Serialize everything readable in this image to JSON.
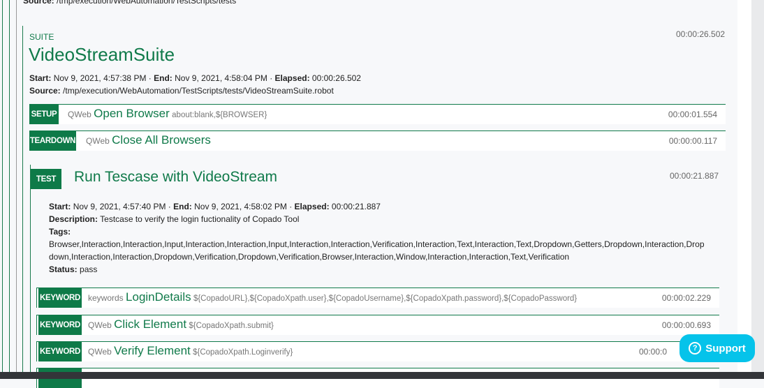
{
  "parent_source": {
    "label": "Source:",
    "value": "/tmp/execution/WebAutomation/TestScripts/tests"
  },
  "suite": {
    "kind": "SUITE",
    "name": "VideoStreamSuite",
    "elapsed": "00:00:26.502",
    "start_label": "Start:",
    "start": "Nov 9, 2021, 4:57:38 PM",
    "end_label": "End:",
    "end": "Nov 9, 2021, 4:58:04 PM",
    "elapsed_label": "Elapsed:",
    "source_label": "Source:",
    "source": "/tmp/execution/WebAutomation/TestScripts/tests/VideoStreamSuite.robot",
    "setup": {
      "badge": "SETUP",
      "lib": "QWeb",
      "name": "Open Browser",
      "args": "about:blank,${BROWSER}",
      "duration": "00:00:01.554"
    },
    "teardown": {
      "badge": "TEARDOWN",
      "lib": "QWeb",
      "name": "Close All Browsers",
      "args": "",
      "duration": "00:00:00.117"
    }
  },
  "test": {
    "badge": "TEST",
    "name": "Run Tescase with VideoStream",
    "duration": "00:00:21.887",
    "start_label": "Start:",
    "start": "Nov 9, 2021, 4:57:40 PM",
    "end_label": "End:",
    "end": "Nov 9, 2021, 4:58:02 PM",
    "elapsed_label": "Elapsed:",
    "elapsed": "00:00:21.887",
    "description_label": "Description:",
    "description": "Testcase to verify the login fuctionality of Copado Tool",
    "tags_label": "Tags:",
    "tags_line1": "Browser,Interaction,Interaction,Input,Interaction,Interaction,Input,Interaction,Interaction,Verification,Interaction,Text,Interaction,Text,Dropdown,Getters,Dropdown,Interaction,Drop",
    "tags_line2": "down,Interaction,Interaction,Dropdown,Verification,Dropdown,Verification,Browser,Interaction,Window,Interaction,Interaction,Text,Verification",
    "status_label": "Status:",
    "status": "pass",
    "keywords": [
      {
        "badge": "KEYWORD",
        "lib": "keywords",
        "name": "LoginDetails",
        "args": "${CopadoURL},${CopadoXpath.user},${CopadoUsername},${CopadoXpath.password},${CopadoPassword}",
        "duration": "00:00:02.229"
      },
      {
        "badge": "KEYWORD",
        "lib": "QWeb",
        "name": "Click Element",
        "args": "${CopadoXpath.submit}",
        "duration": "00:00:00.693"
      },
      {
        "badge": "KEYWORD",
        "lib": "QWeb",
        "name": "Verify Element",
        "args": "${CopadoXpath.Loginverify}",
        "duration": "00:00:0"
      }
    ]
  },
  "support": {
    "label": "Support",
    "icon": "question-circle-icon",
    "color": "#05c3ea"
  },
  "colors": {
    "accent": "#107a4a",
    "badge": "#0e7a48"
  }
}
